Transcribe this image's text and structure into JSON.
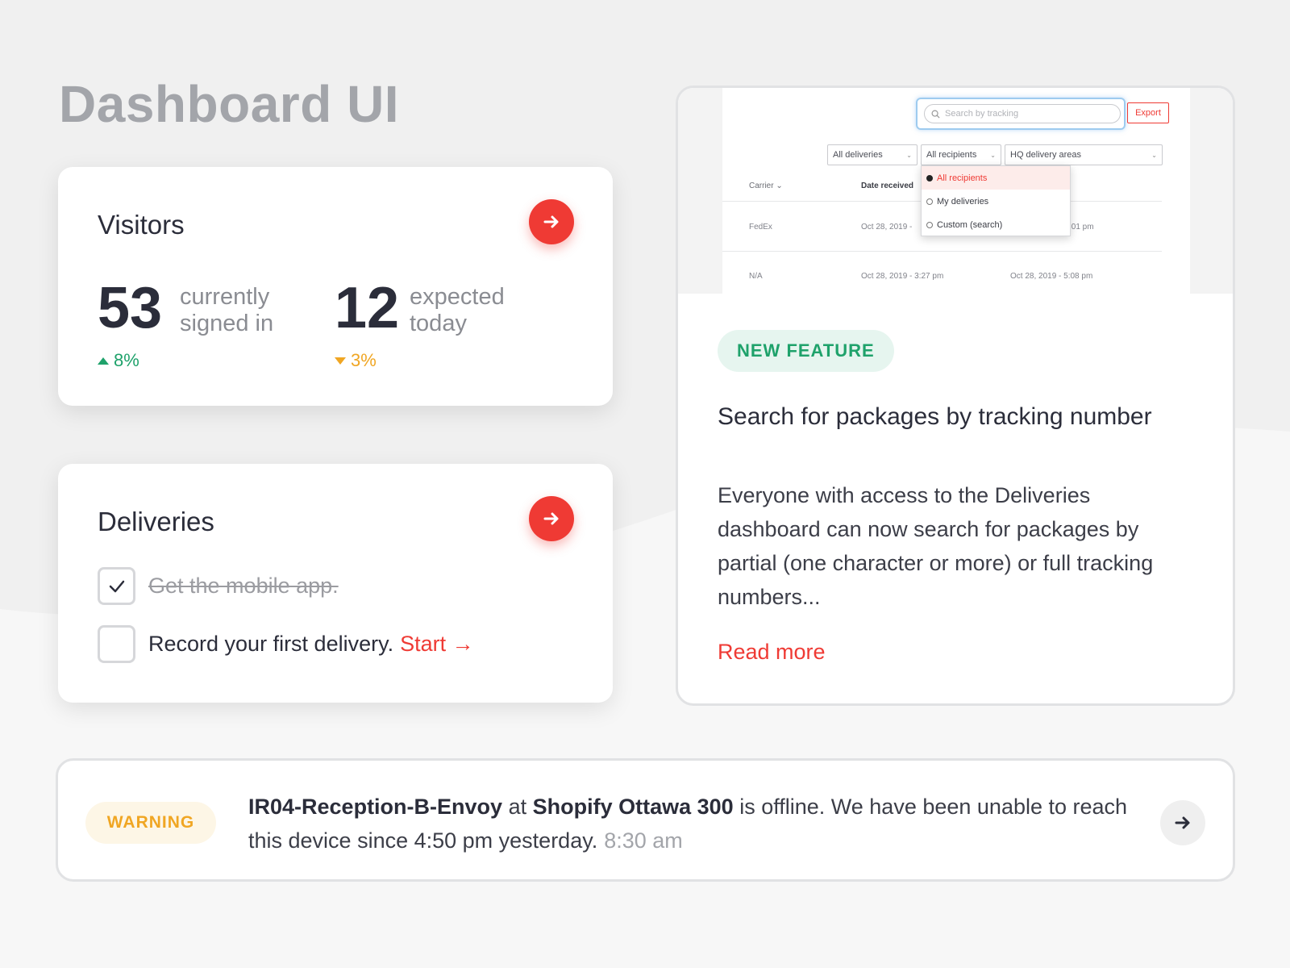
{
  "page": {
    "title": "Dashboard UI"
  },
  "colors": {
    "accent": "#ef3a34",
    "positive": "#1fa26b",
    "warning": "#f0a623",
    "muted": "#a3a5aa"
  },
  "visitors": {
    "title": "Visitors",
    "stats": [
      {
        "value": "53",
        "desc_line1": "currently",
        "desc_line2": "signed in",
        "change": "8%",
        "direction": "up"
      },
      {
        "value": "12",
        "desc_line1": "expected",
        "desc_line2": "today",
        "change": "3%",
        "direction": "down"
      }
    ]
  },
  "deliveries": {
    "title": "Deliveries",
    "tasks": [
      {
        "label": "Get the mobile app.",
        "done": true
      },
      {
        "label": "Record your first delivery.",
        "done": false,
        "action": "Start →"
      }
    ]
  },
  "feature": {
    "preview": {
      "search_placeholder": "Search by tracking",
      "export_label": "Export",
      "filters": [
        "All deliveries",
        "All recipients",
        "HQ delivery areas"
      ],
      "dropdown_options": [
        "All recipients",
        "My deliveries",
        "Custom (search)"
      ],
      "columns": [
        "Carrier",
        "Date received"
      ],
      "rows": [
        {
          "carrier": "FedEx",
          "date": "Oct 28, 2019 -",
          "date2": ":01 pm"
        },
        {
          "carrier": "N/A",
          "date": "Oct 28, 2019 - 3:27 pm",
          "date2": "Oct 28, 2019 - 5:08 pm"
        }
      ]
    },
    "badge": "NEW FEATURE",
    "title": "Search for packages by tracking number",
    "description": "Everyone with access to the Deliveries dashboard can now search for packages by partial (one character or more) or full tracking numbers...",
    "link": "Read more"
  },
  "warning": {
    "badge": "WARNING",
    "device": "IR04-Reception-B-Envoy",
    "connector": "at",
    "location": "Shopify Ottawa 300",
    "message": "is offline. We have been unable to reach this device since 4:50 pm yesterday.",
    "time": "8:30 am"
  }
}
